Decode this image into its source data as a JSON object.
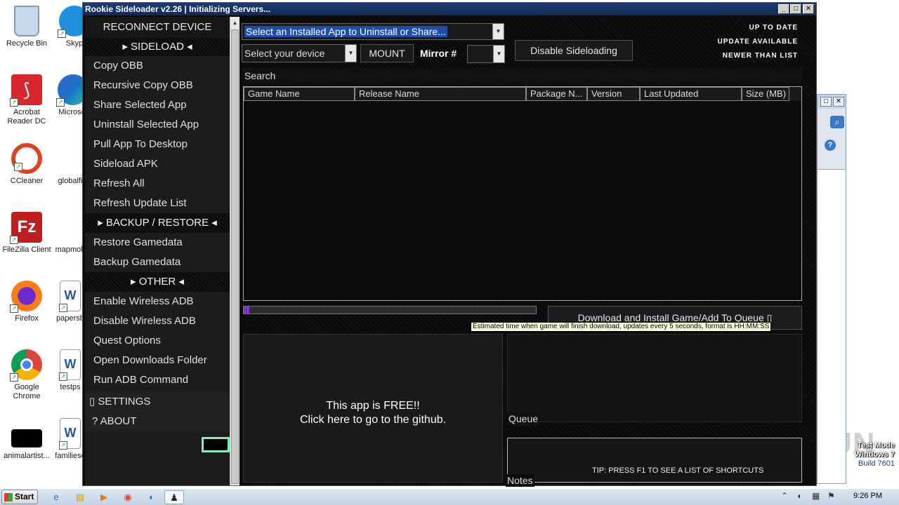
{
  "desktop": {
    "icons": [
      {
        "label": "Recycle Bin",
        "color": "#9fb8d8"
      },
      {
        "label": "Acrobat Reader DC",
        "color": "#d9262c"
      },
      {
        "label": "CCleaner",
        "color": "#e04020"
      },
      {
        "label": "FileZilla Client",
        "color": "#bf1e1e"
      },
      {
        "label": "Firefox",
        "color": "#ff7a18"
      },
      {
        "label": "Google Chrome",
        "color": "#2a8f3a"
      },
      {
        "label": "animalartist...",
        "color": "#000000"
      },
      {
        "label": "Skyp",
        "color": "#1f8fe0"
      },
      {
        "label": "Microsof",
        "color": "#1a73c8"
      },
      {
        "label": "globalfi",
        "color": "#ffffff"
      },
      {
        "label": "mapmob",
        "color": "#ffffff"
      },
      {
        "label": "papersb",
        "color": "#2b5797"
      },
      {
        "label": "testps",
        "color": "#2b5797"
      },
      {
        "label": "familiese",
        "color": "#2b5797"
      }
    ],
    "watermark": "ANY RUN",
    "testmode": {
      "line1": "Test Mode",
      "line2": "Windows 7",
      "line3": "Build 7601"
    }
  },
  "window": {
    "title": "Rookie Sideloader v2.26 | Initializing Servers...",
    "min": "_",
    "max": "□",
    "close": "✕"
  },
  "sidebar": {
    "reconnect": "RECONNECT DEVICE",
    "sideload_header": "▸ SIDELOAD ◂",
    "sideload_items": [
      "Copy OBB",
      "Recursive Copy OBB",
      "Share Selected App",
      "Uninstall Selected App",
      "Pull App To Desktop",
      "Sideload APK",
      "Refresh All",
      "Refresh Update List"
    ],
    "backup_header": "▸ BACKUP / RESTORE ◂",
    "backup_items": [
      "Restore Gamedata",
      "Backup Gamedata"
    ],
    "other_header": "▸ OTHER ◂",
    "other_items": [
      "Enable  Wireless ADB",
      "Disable Wireless ADB",
      "Quest Options",
      "Open Downloads Folder",
      "Run ADB Command"
    ],
    "settings": "▯ SETTINGS",
    "about": "?   ABOUT"
  },
  "main": {
    "installed_combo": "Select an Installed App to Uninstall or Share...",
    "device_combo": "Select your device",
    "mount": "MOUNT",
    "mirror_label": "Mirror #",
    "disable_sideloading": "Disable Sideloading",
    "status": {
      "up_to_date": "UP TO DATE",
      "update_available": "UPDATE AVAILABLE",
      "newer_than_list": "NEWER THAN LIST"
    },
    "search_label": "Search",
    "columns": [
      "Game Name",
      "Release Name",
      "Package N...",
      "Version",
      "Last Updated",
      "Size (MB)"
    ],
    "download_button": "Download  and  Install  Game/Add  To  Queue ▯",
    "progress_percent": 1,
    "progress_color": "#8a2bd0",
    "tooltip": "Estimated time when game will finish download, updates every 5 seconds, format is HH:MM:SS",
    "free_line1": "This app is FREE!!",
    "free_line2": "Click here to go to the github.",
    "queue_label": "Queue",
    "notes_label": "Notes",
    "tip": "TIP: PRESS F1 TO SEE A LIST OF SHORTCUTS"
  },
  "taskbar": {
    "start": "Start",
    "clock": "9:26 PM"
  }
}
